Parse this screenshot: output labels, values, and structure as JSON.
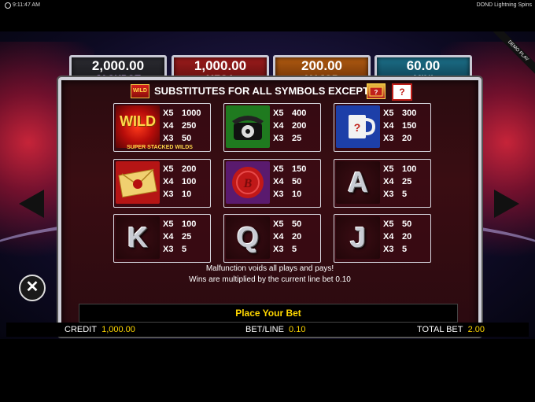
{
  "status_bar": {
    "time": "9:11:47 AM",
    "game_name": "DOND Lightning Spins"
  },
  "ribbon": "DEMO PLAY",
  "jackpots": [
    {
      "amount": "2,000.00",
      "label": "JACKPOT"
    },
    {
      "amount": "1,000.00",
      "label": "MEGA"
    },
    {
      "amount": "200.00",
      "label": "MAJOR"
    },
    {
      "amount": "60.00",
      "label": "MINI"
    }
  ],
  "paytable": {
    "wild_icon_text": "WILD",
    "substitutes_text": "SUBSTITUTES FOR ALL SYMBOLS EXCEPT",
    "except_icon_text": "?",
    "wild_symbol_text": "WILD",
    "wild_caption": "SUPER STACKED WILDS",
    "cells": [
      {
        "symbol": "wild-icon",
        "pays": [
          [
            "X5",
            "1000"
          ],
          [
            "X4",
            "250"
          ],
          [
            "X3",
            "50"
          ]
        ]
      },
      {
        "symbol": "telephone-icon",
        "pays": [
          [
            "X5",
            "400"
          ],
          [
            "X4",
            "200"
          ],
          [
            "X3",
            "25"
          ]
        ]
      },
      {
        "symbol": "mug-icon",
        "pays": [
          [
            "X5",
            "300"
          ],
          [
            "X4",
            "150"
          ],
          [
            "X3",
            "20"
          ]
        ]
      },
      {
        "symbol": "envelope-icon",
        "pays": [
          [
            "X5",
            "200"
          ],
          [
            "X4",
            "100"
          ],
          [
            "X3",
            "10"
          ]
        ]
      },
      {
        "symbol": "wax-seal-icon",
        "pays": [
          [
            "X5",
            "150"
          ],
          [
            "X4",
            "50"
          ],
          [
            "X3",
            "10"
          ]
        ]
      },
      {
        "symbol": "A",
        "pays": [
          [
            "X5",
            "100"
          ],
          [
            "X4",
            "25"
          ],
          [
            "X3",
            "5"
          ]
        ]
      },
      {
        "symbol": "K",
        "pays": [
          [
            "X5",
            "100"
          ],
          [
            "X4",
            "25"
          ],
          [
            "X3",
            "5"
          ]
        ]
      },
      {
        "symbol": "Q",
        "pays": [
          [
            "X5",
            "50"
          ],
          [
            "X4",
            "20"
          ],
          [
            "X3",
            "5"
          ]
        ]
      },
      {
        "symbol": "J",
        "pays": [
          [
            "X5",
            "50"
          ],
          [
            "X4",
            "20"
          ],
          [
            "X3",
            "5"
          ]
        ]
      }
    ],
    "footer_line1": "Malfunction voids all plays and pays!",
    "footer_line2": "Wins are multiplied by the current line bet  0.10"
  },
  "controls": {
    "close_icon": "✕",
    "place_bet": "Place Your Bet"
  },
  "bottom_bar": {
    "credit_label": "CREDIT",
    "credit_value": "1,000.00",
    "betline_label": "BET/LINE",
    "betline_value": "0.10",
    "totalbet_label": "TOTAL BET",
    "totalbet_value": "2.00"
  },
  "colors": {
    "accent_gold": "#ffd700",
    "frame": "#cfcfd8",
    "panel_bg": "#2a0c10"
  }
}
